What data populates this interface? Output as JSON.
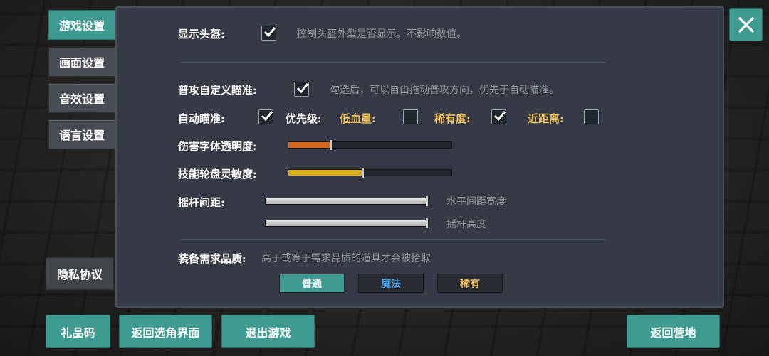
{
  "tabs": [
    {
      "label": "游戏设置",
      "active": true
    },
    {
      "label": "画面设置",
      "active": false
    },
    {
      "label": "音效设置",
      "active": false
    },
    {
      "label": "语言设置",
      "active": false
    }
  ],
  "privacy_label": "隐私协议",
  "close_icon": "close-icon",
  "settings": {
    "helmet": {
      "label": "显示头盔:",
      "checked": true,
      "hint": "控制头盔外型是否显示。不影响数值。"
    },
    "custom_aim": {
      "label": "普攻自定义瞄准:",
      "checked": true,
      "hint": "勾选后，可以自由拖动普攻方向，优先于自动瞄准。"
    },
    "auto_aim": {
      "label": "自动瞄准:",
      "checked": true
    },
    "priority": {
      "label": "优先级:",
      "low_hp": {
        "label": "低血量:",
        "checked": false
      },
      "rarity": {
        "label": "稀有度:",
        "checked": true
      },
      "nearest": {
        "label": "近距离:",
        "checked": false
      }
    },
    "damage_text_opacity": {
      "label": "伤害字体透明度:",
      "level": 0.26,
      "color": "#d4671e"
    },
    "skill_wheel_sensitivity": {
      "label": "技能轮盘灵敏度:",
      "level": 0.46,
      "color": "#d8ae14"
    },
    "joystick": {
      "label": "摇杆间距:",
      "horizontal": {
        "hint": "水平间距宽度",
        "level": 1.0
      },
      "height": {
        "hint": "摇杆高度",
        "level": 1.0
      }
    },
    "equipment_quality": {
      "label": "装备需求品质:",
      "hint": "高于或等于需求品质的道具才会被拾取",
      "options": [
        {
          "label": "普通",
          "selected": true,
          "color": "#ffffff"
        },
        {
          "label": "魔法",
          "selected": false,
          "color": "#4aa3e8"
        },
        {
          "label": "稀有",
          "selected": false,
          "color": "#f1c15c"
        }
      ]
    }
  },
  "bottom": {
    "gift_code": "礼品码",
    "back_to_select": "返回选角界面",
    "exit_game": "退出游戏",
    "back_to_camp": "返回营地"
  },
  "colors": {
    "accent": "#3f9a91",
    "gold": "#f1c15c",
    "blue": "#4aa3e8"
  }
}
